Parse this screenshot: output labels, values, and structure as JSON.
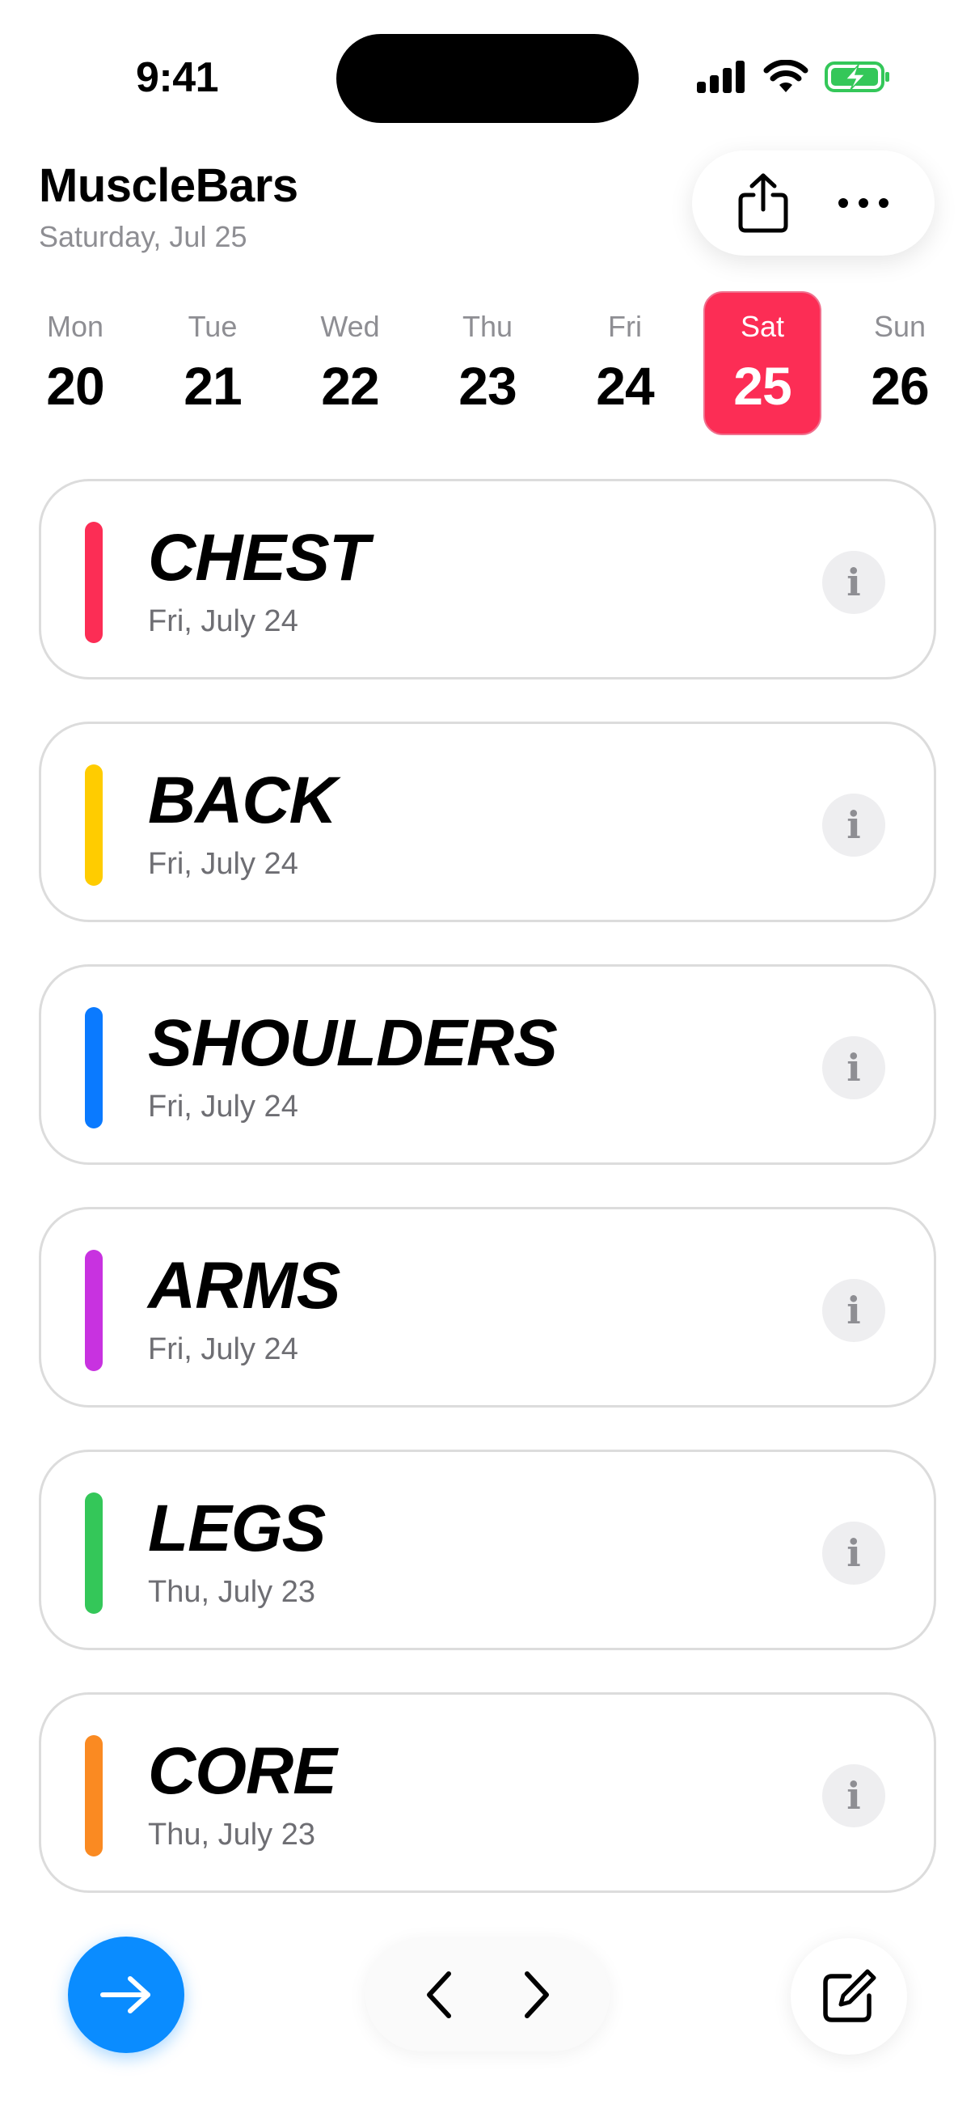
{
  "status_bar": {
    "time": "9:41"
  },
  "header": {
    "title": "MuscleBars",
    "date": "Saturday, Jul 25"
  },
  "week": [
    {
      "name": "Mon",
      "num": "20",
      "selected": false
    },
    {
      "name": "Tue",
      "num": "21",
      "selected": false
    },
    {
      "name": "Wed",
      "num": "22",
      "selected": false
    },
    {
      "name": "Thu",
      "num": "23",
      "selected": false
    },
    {
      "name": "Fri",
      "num": "24",
      "selected": false
    },
    {
      "name": "Sat",
      "num": "25",
      "selected": true
    },
    {
      "name": "Sun",
      "num": "26",
      "selected": false
    }
  ],
  "muscles": [
    {
      "name": "CHEST",
      "date": "Fri, July 24",
      "color": "#fc2d55"
    },
    {
      "name": "BACK",
      "date": "Fri, July 24",
      "color": "#ffcc00"
    },
    {
      "name": "SHOULDERS",
      "date": "Fri, July 24",
      "color": "#0a7aff"
    },
    {
      "name": "ARMS",
      "date": "Fri, July 24",
      "color": "#c832e0"
    },
    {
      "name": "LEGS",
      "date": "Thu, July 23",
      "color": "#34c759"
    },
    {
      "name": "CORE",
      "date": "Thu, July 23",
      "color": "#fa8a22"
    }
  ],
  "icons": {
    "share": "share-icon",
    "more": "ellipsis-icon",
    "info": "i",
    "go": "arrow-right-icon",
    "prev": "chevron-left-icon",
    "next": "chevron-right-icon",
    "edit": "compose-icon"
  },
  "colors": {
    "accent": "#fc2d55",
    "fab": "#0a8cff",
    "battery": "#34c759"
  }
}
